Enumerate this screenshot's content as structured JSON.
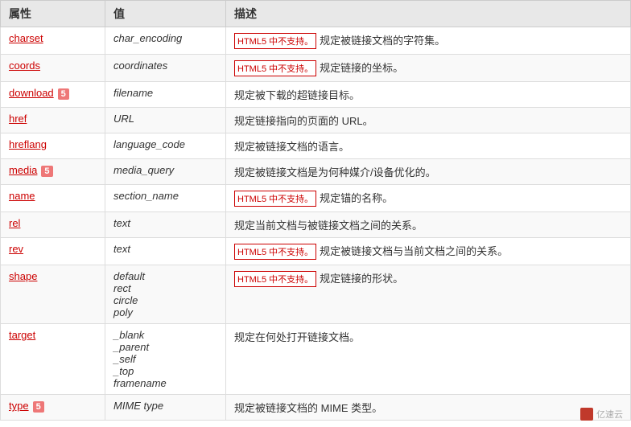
{
  "table": {
    "headers": [
      "属性",
      "值",
      "描述"
    ],
    "rows": [
      {
        "attr": "charset",
        "attr_link": true,
        "html5_new": false,
        "value": "char_encoding",
        "html5_badge": true,
        "desc": "规定被链接文档的字符集。"
      },
      {
        "attr": "coords",
        "attr_link": true,
        "html5_new": false,
        "value": "coordinates",
        "html5_badge": true,
        "desc": "规定链接的坐标。"
      },
      {
        "attr": "download",
        "attr_link": true,
        "html5_new": true,
        "value": "filename",
        "html5_badge": false,
        "desc": "规定被下载的超链接目标。"
      },
      {
        "attr": "href",
        "attr_link": true,
        "html5_new": false,
        "value": "URL",
        "html5_badge": false,
        "desc": "规定链接指向的页面的 URL。"
      },
      {
        "attr": "hreflang",
        "attr_link": true,
        "html5_new": false,
        "value": "language_code",
        "html5_badge": false,
        "desc": "规定被链接文档的语言。"
      },
      {
        "attr": "media",
        "attr_link": true,
        "html5_new": true,
        "value": "media_query",
        "html5_badge": false,
        "desc": "规定被链接文档是为何种媒介/设备优化的。"
      },
      {
        "attr": "name",
        "attr_link": true,
        "html5_new": false,
        "value": "section_name",
        "html5_badge": true,
        "desc": "规定锚的名称。"
      },
      {
        "attr": "rel",
        "attr_link": true,
        "html5_new": false,
        "value": "text",
        "html5_badge": false,
        "desc": "规定当前文档与被链接文档之间的关系。"
      },
      {
        "attr": "rev",
        "attr_link": true,
        "html5_new": false,
        "value": "text",
        "html5_badge": true,
        "desc": "规定被链接文档与当前文档之间的关系。"
      },
      {
        "attr": "shape",
        "attr_link": true,
        "html5_new": false,
        "value": "default\nrect\ncircle\npoly",
        "html5_badge": true,
        "desc": "规定链接的形状。"
      },
      {
        "attr": "target",
        "attr_link": true,
        "html5_new": false,
        "value": "_blank\n_parent\n_self\n_top\nframename",
        "html5_badge": false,
        "desc": "规定在何处打开链接文档。"
      },
      {
        "attr": "type",
        "attr_link": true,
        "html5_new": true,
        "value": "MIME type",
        "html5_badge": false,
        "desc": "规定被链接文档的 MIME 类型。"
      }
    ]
  },
  "watermark": {
    "text": "亿速云"
  },
  "html5_not_supported_label": "HTML5 中不支持。",
  "html5_new_icon_label": "5"
}
